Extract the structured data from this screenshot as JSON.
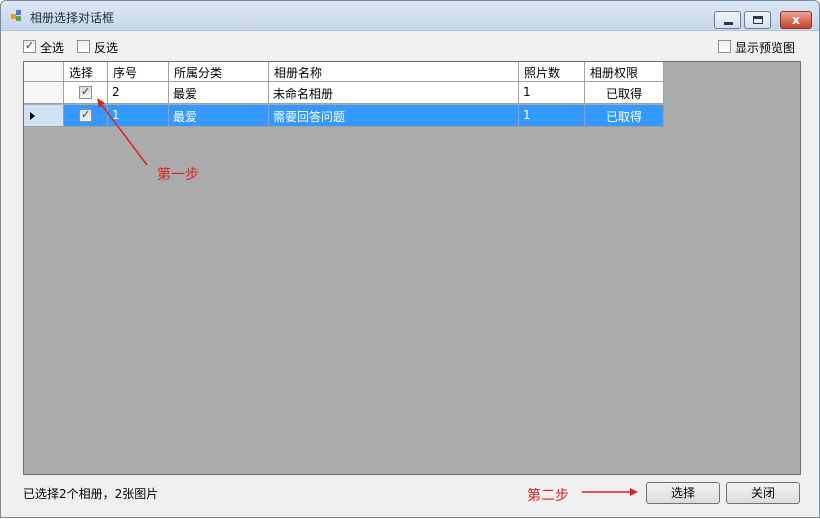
{
  "window": {
    "title": "相册选择对话框",
    "close_glyph": "x"
  },
  "toolbar": {
    "select_all": {
      "label": "全选",
      "checked": true
    },
    "invert": {
      "label": "反选",
      "checked": false
    },
    "show_preview": {
      "label": "显示预览图",
      "checked": false
    }
  },
  "table": {
    "columns": [
      "选择",
      "序号",
      "所属分类",
      "相册名称",
      "照片数",
      "相册权限"
    ],
    "rows": [
      {
        "selected": true,
        "index": "2",
        "category": "最爱",
        "name": "未命名相册",
        "photos": "1",
        "permission": "已取得",
        "highlighted": false
      },
      {
        "selected": true,
        "index": "1",
        "category": "最爱",
        "name": "需要回答问题",
        "photos": "1",
        "permission": "已取得",
        "highlighted": true
      }
    ]
  },
  "annotations": {
    "step1": "第一步",
    "step2": "第二步",
    "color": "#e02020"
  },
  "status": {
    "text": "已选择2个相册，2张图片"
  },
  "buttons": {
    "select": "选择",
    "close": "关闭"
  },
  "colors": {
    "selection": "#3399ff",
    "grid_background": "#ababab",
    "window_background": "#f0f0f0"
  }
}
